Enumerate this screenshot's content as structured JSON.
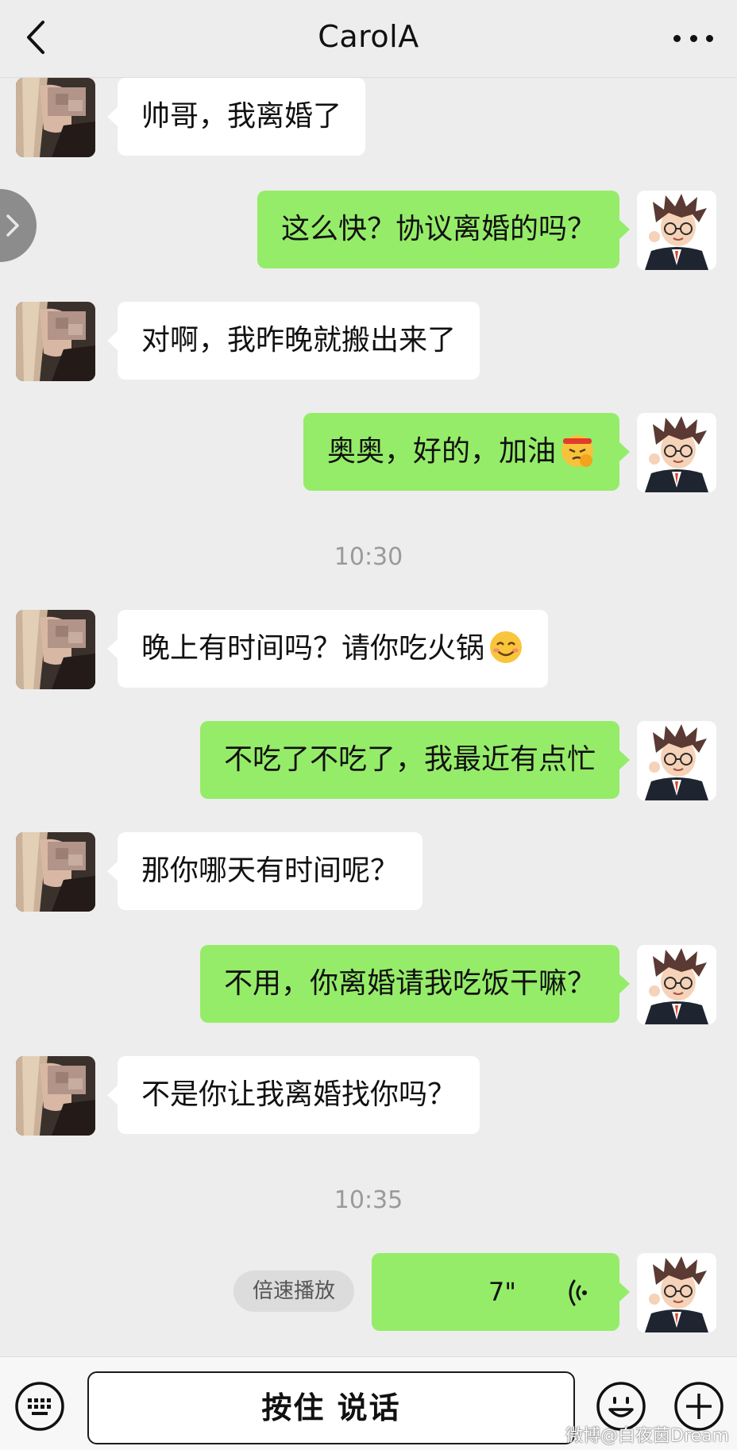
{
  "header": {
    "title": "CarolA",
    "back_icon": "chevron-left-icon",
    "more_icon": "more-dots-icon"
  },
  "colors": {
    "background": "#ededed",
    "incoming_bubble": "#ffffff",
    "outgoing_bubble": "#95ec69",
    "timestamp": "#9a9a9a"
  },
  "messages": [
    {
      "sender": "contact",
      "text": "帅哥，我离婚了"
    },
    {
      "sender": "me",
      "text": "这么快？协议离婚的吗？"
    },
    {
      "sender": "contact",
      "text": "对啊，我昨晚就搬出来了"
    },
    {
      "sender": "me",
      "text": "奥奥，好的，加油",
      "emoji": "fighting-face-emoji"
    },
    {
      "sender": "time",
      "text": "10:30"
    },
    {
      "sender": "contact",
      "text": "晚上有时间吗？请你吃火锅",
      "emoji": "smiling-face-emoji"
    },
    {
      "sender": "me",
      "text": "不吃了不吃了，我最近有点忙"
    },
    {
      "sender": "contact",
      "text": "那你哪天有时间呢？"
    },
    {
      "sender": "me",
      "text": "不用，你离婚请我吃饭干嘛？"
    },
    {
      "sender": "contact",
      "text": "不是你让我离婚找你吗？"
    },
    {
      "sender": "time",
      "text": "10:35"
    },
    {
      "sender": "me",
      "type": "voice",
      "duration": "7\"",
      "speed_label": "倍速播放"
    }
  ],
  "input_bar": {
    "keyboard_icon": "keyboard-icon",
    "talk_label": "按住 说话",
    "emoji_icon": "emoji-icon",
    "plus_icon": "plus-icon"
  },
  "watermark": "微博@白夜茵Dream"
}
